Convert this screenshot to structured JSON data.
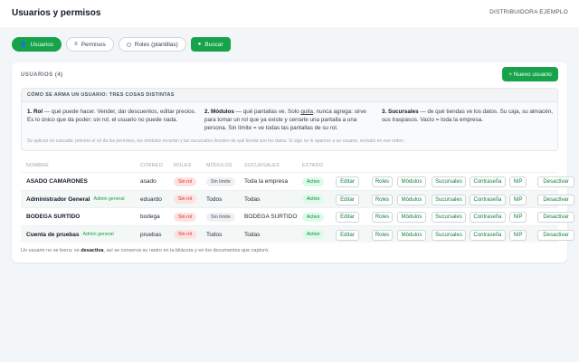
{
  "header": {
    "title": "Usuarios y permisos",
    "company": "DISTRIBUIDORA EJEMPLO"
  },
  "tabs": [
    {
      "label": "Usuarios",
      "icon": "user-icon"
    },
    {
      "label": "Permisos",
      "icon": "lock-icon"
    },
    {
      "label": "Roles (plantillas)",
      "icon": "circle-icon"
    },
    {
      "label": "Buscar",
      "icon": "search-icon"
    }
  ],
  "card": {
    "title": "USUARIOS (4)",
    "new_button": "+ Nuevo usuario"
  },
  "info": {
    "heading": "CÓMO SE ARMA UN USUARIO: TRES COSAS DISTINTAS",
    "rol": {
      "title": "1. Rol",
      "text_a": " — qué puede hacer. Vender, dar descuentos, editar precios.",
      "text_b": "Es lo único que da poder: sin rol, el usuario no puede nada."
    },
    "modulos": {
      "title": "2. Módulos",
      "text_a": " — qué pantallas ve. Solo ",
      "quita": "quita",
      "text_a2": ", nunca agrega: sirve",
      "text_b": "para tomar un rol que ya existe y cerrarle una pantalla a una",
      "text_c": "persona. Sin límite = ve todas las pantallas de su rol."
    },
    "sucursales": {
      "title": "3. Sucursales",
      "text_a": " — de qué tiendas ve los datos. Su caja, su almacén,",
      "text_b": "sus traspasos. Vacío = toda la empresa."
    },
    "footer": "Se aplican en cascada: primero el rol da los permisos, los módulos recortan y las sucursales deciden de qué tienda son los datos. Si algo no le aparece a un usuario, revísalo en ese orden."
  },
  "table": {
    "headers": [
      "NOMBRE",
      "CORREO",
      "ROLES",
      "MÓDULOS",
      "SUCURSALES",
      "ESTADO"
    ],
    "actions": [
      "Editar",
      "Roles",
      "Módulos",
      "Sucursales",
      "Contraseña",
      "NIP",
      "Desactivar"
    ],
    "rows": [
      {
        "name": "ASADO CAMARONES",
        "tag": "",
        "email": "asado",
        "roles": "Sin rol",
        "modules": "Sin límite",
        "modules_plain": false,
        "branches": "Toda la empresa",
        "status": "Activo"
      },
      {
        "name": "Administrador General",
        "tag": "Admin general",
        "email": "eduardo",
        "roles": "Sin rol",
        "modules": "Todos",
        "modules_plain": true,
        "branches": "Todas",
        "status": "Activo"
      },
      {
        "name": "BODEGA SURTIDO",
        "tag": "",
        "email": "bodega",
        "roles": "Sin rol",
        "modules": "Sin límite",
        "modules_plain": false,
        "branches": "BODEGA SURTIDO",
        "status": "Activo"
      },
      {
        "name": "Cuenta de pruebas",
        "tag": "Admin general",
        "email": "pruebas",
        "roles": "Sin rol",
        "modules": "Todos",
        "modules_plain": true,
        "branches": "Todas",
        "status": "Activo"
      }
    ]
  },
  "footnote": {
    "a": "Un usuario no se borra: se ",
    "b": "desactiva",
    "c": ", así se conserva su rastro en la bitácora y en los documentos que capturó."
  }
}
